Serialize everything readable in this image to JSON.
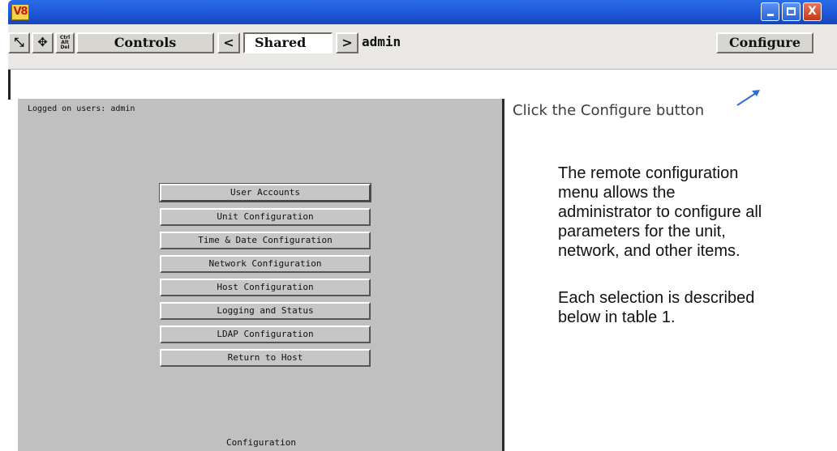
{
  "titlebar": {
    "app_logo": "V8",
    "minimize_icon": "minimize-icon",
    "maximize_icon": "maximize-icon",
    "close_icon": "close-icon",
    "close_glyph": "X"
  },
  "toolbar": {
    "scale_icon": "fit-window-icon",
    "scale_glyph": "⤡",
    "move_icon": "move-icon",
    "move_glyph": "✥",
    "cad_icon": "ctrl-alt-del-icon",
    "cad_lines": [
      "Ctrl",
      "Alt",
      "Del"
    ],
    "controls_label": "Controls",
    "prev_glyph": "<",
    "shared_label": "Shared",
    "next_glyph": ">",
    "user_label": "admin",
    "configure_label": "Configure"
  },
  "kvm": {
    "logged_on": "Logged on users: admin",
    "menu": [
      "User Accounts",
      "Unit Configuration",
      "Time & Date Configuration",
      "Network Configuration",
      "Host Configuration",
      "Logging and Status",
      "LDAP Configuration",
      "Return to Host"
    ],
    "footer": "Configuration"
  },
  "annotation": {
    "callout": "Click the Configure button",
    "arrow_icon": "arrow-up-right-icon",
    "desc_lines_1": [
      "The remote configuration",
      "menu allows the",
      "administrator to configure all",
      "parameters for the unit,",
      "network, and other items."
    ],
    "desc_lines_2": [
      "Each selection is described",
      "below in table 1."
    ]
  }
}
